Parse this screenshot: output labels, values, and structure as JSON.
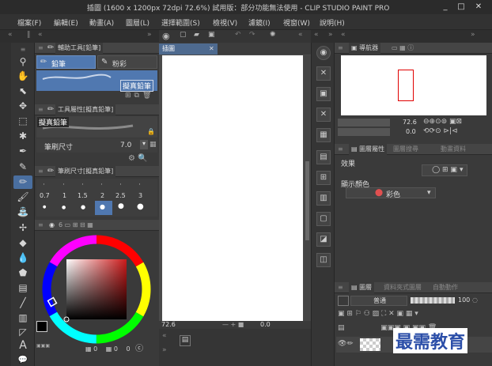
{
  "window": {
    "title": "插圖 (1600 x 1200px 72dpi 72.6%)  試用版：部分功能無法使用 - CLIP STUDIO PAINT PRO",
    "controls": [
      "_",
      "□",
      "✕"
    ]
  },
  "menu": [
    "檔案(F)",
    "編輯(E)",
    "動畫(A)",
    "圖層(L)",
    "選擇範圍(S)",
    "檢視(V)",
    "濾鏡(I)",
    "視窗(W)",
    "說明(H)"
  ],
  "sub_tool": {
    "tab_label": "輔助工具[鉛筆]",
    "tabs": [
      "鉛筆",
      "粉彩"
    ],
    "selected_brush": "擬真鉛筆"
  },
  "tool_property": {
    "tab_label": "工具屬性[擬真鉛筆]",
    "brush_name": "擬真鉛筆",
    "brush_size_label": "筆刷尺寸",
    "brush_size_value": "7.0"
  },
  "brush_size_panel": {
    "tab_label": "筆刷尺寸[擬真鉛筆]",
    "sizes": [
      "0.7",
      "1",
      "1.5",
      "2",
      "2.5",
      "3"
    ]
  },
  "color": {
    "values": [
      "0",
      "0",
      "0"
    ],
    "main_color": "#000000",
    "sub_color": "#ffffff",
    "hue_square_color": "#cc1a1a"
  },
  "canvas": {
    "tab_label": "插圖",
    "zoom": "72.6",
    "angle": "0.0"
  },
  "navigator": {
    "tab_label": "導航器",
    "zoom": "72.6",
    "angle": "0.0"
  },
  "layer_property": {
    "tab_label": "圖層屬性",
    "tab2_label": "圖層搜尋",
    "tab3_label": "動畫資料",
    "effect_label": "效果",
    "display_color_label": "顯示顏色",
    "display_color_value": "彩色"
  },
  "layers": {
    "tab_label": "圖層",
    "tab2_label": "資料夾式圖層",
    "tab3_label": "自動動作",
    "blend_mode": "普通",
    "opacity": "100"
  },
  "watermark": "最需教育"
}
